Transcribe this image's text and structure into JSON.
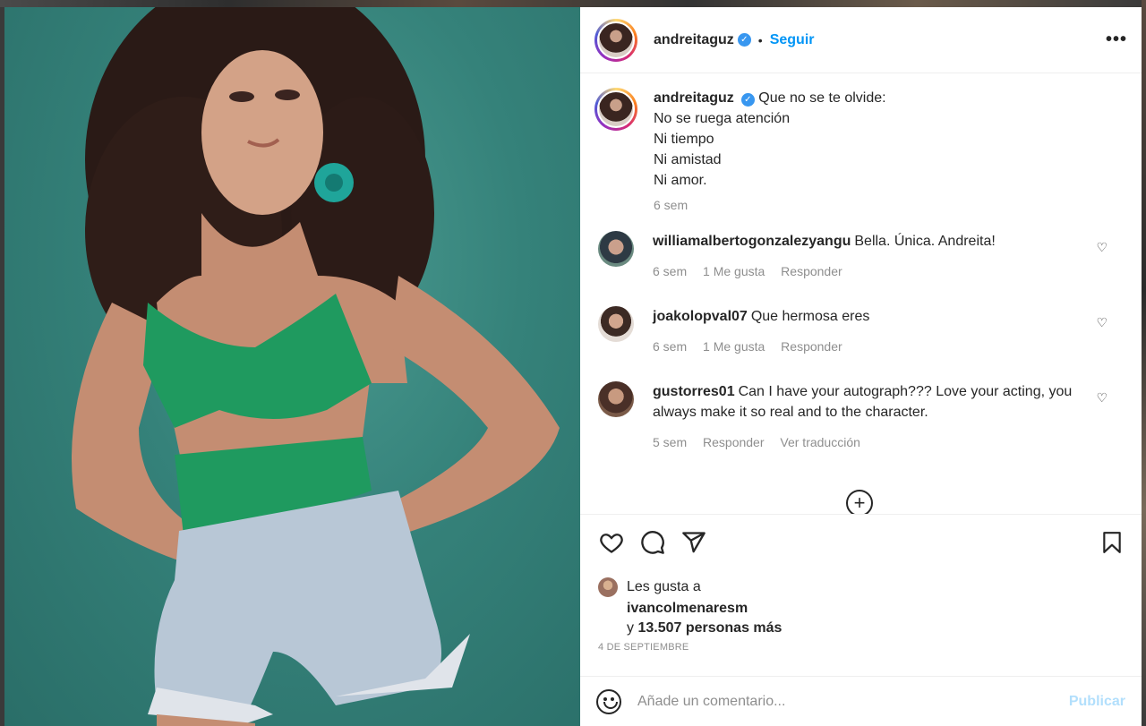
{
  "post": {
    "username": "andreitaguz",
    "follow_label": "Seguir",
    "more_label": "•••",
    "photo_alt": "Mujer de cabello rizado con top verde y short de mezclilla sobre fondo verde azulado"
  },
  "caption": {
    "username": "andreitaguz",
    "first_line": "Que no se te olvide:",
    "lines": [
      "No se ruega atención",
      "Ni tiempo",
      "Ni amistad",
      "Ni amor."
    ],
    "time": "6 sem"
  },
  "comments": [
    {
      "username": "williamalbertogonzalezyangu",
      "text": "Bella. Única. Andreita!",
      "time": "6 sem",
      "likes": "1 Me gusta",
      "reply": "Responder",
      "extra": ""
    },
    {
      "username": "joakolopval07",
      "text": "Que hermosa eres",
      "time": "6 sem",
      "likes": "1 Me gusta",
      "reply": "Responder",
      "extra": ""
    },
    {
      "username": "gustorres01",
      "text": "Can I have your autograph??? Love your acting, you always make it so real and to the character.",
      "time": "5 sem",
      "likes": "",
      "reply": "Responder",
      "extra": "Ver traducción"
    }
  ],
  "load_more_label": "+",
  "likes": {
    "prefix": "Les gusta a",
    "user": "ivancolmenaresm",
    "and": "y",
    "count": "13.507 personas más",
    "date": "4 DE SEPTIEMBRE"
  },
  "composer": {
    "placeholder": "Añade un comentario...",
    "publish_label": "Publicar"
  },
  "colors": {
    "link_blue": "#0095f6",
    "publish_disabled": "#b2dffc",
    "muted": "#8e8e8e",
    "photo_bg": "#35827a"
  },
  "icons": [
    "verified-badge-icon",
    "more-options-icon",
    "heart-icon",
    "comment-icon",
    "share-icon",
    "bookmark-icon",
    "emoji-icon",
    "plus-circle-icon"
  ]
}
